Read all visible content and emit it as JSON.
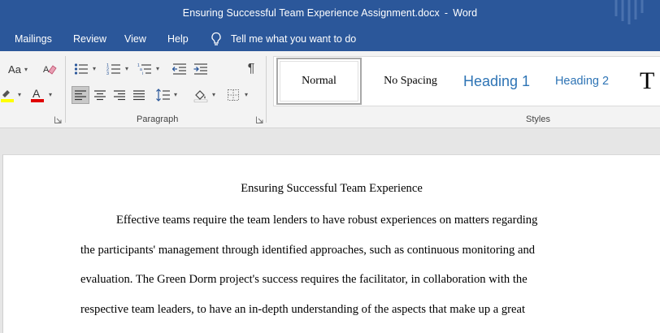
{
  "window": {
    "doc_name": "Ensuring Successful Team Experience Assignment.docx",
    "separator": "-",
    "app_name": "Word"
  },
  "menu": {
    "items": [
      "Mailings",
      "Review",
      "View",
      "Help"
    ],
    "tell_me": "Tell me what you want to do"
  },
  "ribbon": {
    "font_group": {
      "change_case_label": "Aa"
    },
    "paragraph_group": {
      "label": "Paragraph"
    },
    "styles_group": {
      "label": "Styles",
      "styles": [
        "Normal",
        "No Spacing",
        "Heading 1",
        "Heading 2",
        "T"
      ]
    },
    "colors": {
      "highlight": "#ffff00",
      "font_color": "#e00000",
      "accent": "#2b579a",
      "heading": "#2e74b5"
    }
  },
  "document": {
    "title": "Ensuring Successful Team Experience",
    "lines": [
      "Effective teams require the team lenders to have robust experiences on matters regarding",
      "the participants' management through identified approaches, such as continuous monitoring and",
      "evaluation. The Green Dorm project's success requires the facilitator, in collaboration with the",
      "respective team leaders, to have an in-depth understanding of the aspects that make up a great"
    ]
  }
}
